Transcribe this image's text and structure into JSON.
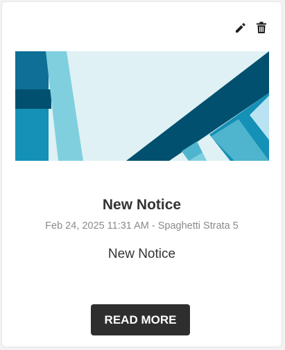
{
  "card": {
    "title": "New Notice",
    "date": "Feb 24, 2025 11:31 AM",
    "separator": " - ",
    "location": "Spaghetti Strata 5",
    "excerpt": "New Notice",
    "read_more_label": "READ MORE"
  },
  "icons": {
    "edit": "pencil-icon",
    "delete": "trash-icon"
  },
  "colors": {
    "button_bg": "#2e2e2e",
    "title": "#333333",
    "meta": "#8a8a8a",
    "banner_dark": "#02506f",
    "banner_mid": "#1590b7",
    "banner_light": "#7fcfdf",
    "banner_pale": "#dff1f4"
  }
}
